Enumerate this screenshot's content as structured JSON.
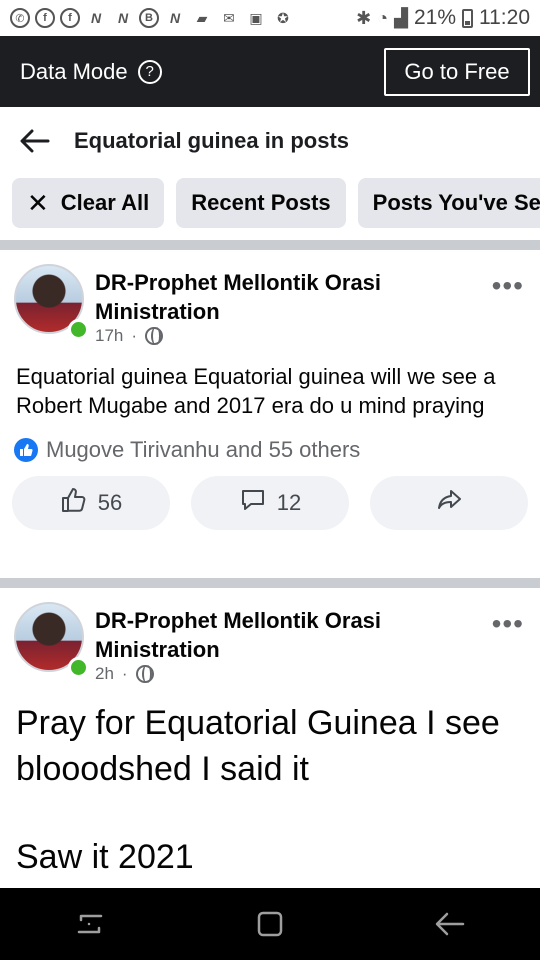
{
  "status_bar": {
    "notification_icons": [
      "whatsapp-icon",
      "facebook-icon",
      "facebook-icon",
      "n-app-icon",
      "n-app-icon",
      "b-app-icon",
      "n-app-icon",
      "message-icon",
      "mail-icon",
      "gallery-icon",
      "photo-icon",
      "badge-icon"
    ],
    "battery": "21%",
    "time": "11:20"
  },
  "data_mode": {
    "label": "Data Mode",
    "help_icon": "?",
    "button": "Go to Free"
  },
  "header": {
    "title": "Equatorial guinea in posts"
  },
  "filters": [
    {
      "label": "Clear All",
      "icon": "close-icon"
    },
    {
      "label": "Recent Posts"
    },
    {
      "label": "Posts You've Seen"
    }
  ],
  "posts": [
    {
      "author_line1": "DR-Prophet Mellontik Orasi",
      "author_line2": "Ministration",
      "time": "17h",
      "separator": "·",
      "text": "Equatorial  guinea Equatorial  guinea will we see a Robert Mugabe and 2017 era do u mind praying",
      "reactions": "Mugove Tirivanhu and 55 others",
      "likes": "56",
      "comments": "12"
    },
    {
      "author_line1": "DR-Prophet Mellontik Orasi",
      "author_line2": "Ministration",
      "time": "2h",
      "separator": "·",
      "text_line1": "Pray for Equatorial Guinea I see",
      "text_line2": "blooodshed I said it",
      "text_line3": "Saw it 2021"
    }
  ],
  "colors": {
    "data_mode_bg": "#1c1e21",
    "chip_bg": "#e4e6eb",
    "online": "#42b72a",
    "like_blue": "#1877f2"
  }
}
